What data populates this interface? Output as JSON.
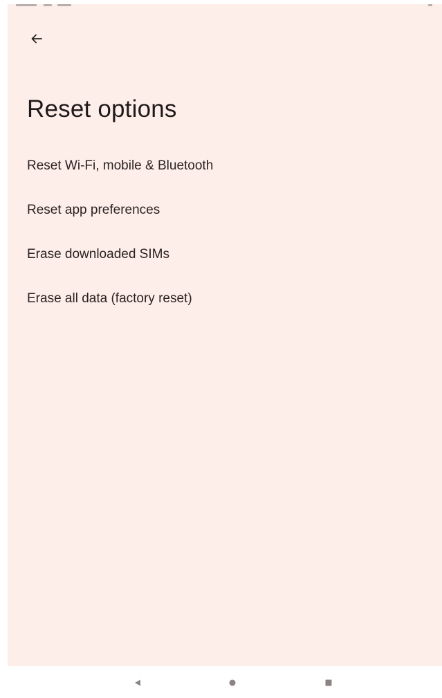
{
  "page": {
    "title": "Reset options"
  },
  "header": {
    "back_icon": "back-arrow-icon"
  },
  "options": [
    {
      "label": "Reset Wi-Fi, mobile & Bluetooth"
    },
    {
      "label": "Reset app preferences"
    },
    {
      "label": "Erase downloaded SIMs"
    },
    {
      "label": "Erase all data (factory reset)"
    }
  ],
  "nav_bar": {
    "back_icon": "triangle-back-icon",
    "home_icon": "circle-home-icon",
    "recents_icon": "square-recents-icon"
  },
  "colors": {
    "background": "#fdeeea",
    "text_primary": "#1f1a19",
    "text_item": "#2a2321",
    "nav_icon": "#8a8583"
  }
}
